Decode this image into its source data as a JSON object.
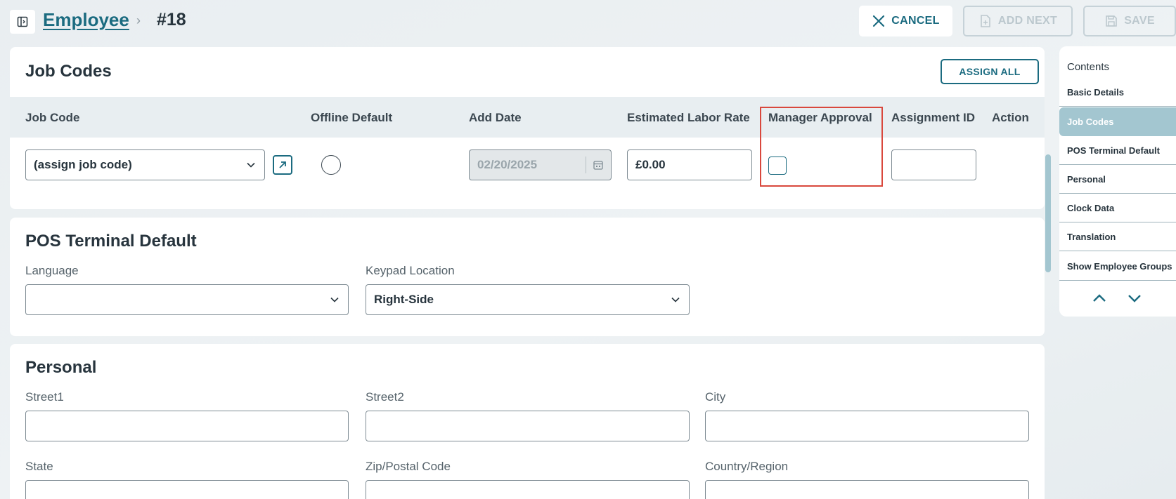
{
  "breadcrumb": {
    "parent": "Employee",
    "separator": "›",
    "current": "#18"
  },
  "toolbar": {
    "cancel_label": "CANCEL",
    "add_next_label": "ADD NEXT",
    "save_label": "SAVE"
  },
  "job_codes": {
    "title": "Job Codes",
    "assign_all_label": "ASSIGN ALL",
    "columns": [
      "Job Code",
      "Offline Default",
      "Add Date",
      "Estimated Labor Rate",
      "Manager Approval",
      "Assignment ID",
      "Action"
    ],
    "row": {
      "job_code": "(assign job code)",
      "add_date": "02/20/2025",
      "labor_rate": "£0.00",
      "assignment_id": ""
    }
  },
  "pos_terminal": {
    "title": "POS Terminal Default",
    "language_label": "Language",
    "language_value": "",
    "keypad_label": "Keypad Location",
    "keypad_value": "Right-Side"
  },
  "personal": {
    "title": "Personal",
    "street1_label": "Street1",
    "street2_label": "Street2",
    "city_label": "City",
    "state_label": "State",
    "zip_label": "Zip/Postal Code",
    "country_label": "Country/Region"
  },
  "contents": {
    "title": "Contents",
    "items": [
      "Basic Details",
      "Job Codes",
      "POS Terminal Default",
      "Personal",
      "Clock Data",
      "Translation",
      "Show Employee Groups"
    ],
    "active": "Job Codes"
  },
  "colors": {
    "accent": "#1b6b80",
    "active_toc": "#a3c6d0",
    "highlight": "#d9483d"
  },
  "icons": [
    "panel-toggle-icon",
    "close-icon",
    "add-next-icon",
    "save-icon",
    "chevron-down-icon",
    "open-link-icon",
    "calendar-icon",
    "chevron-up-icon"
  ]
}
